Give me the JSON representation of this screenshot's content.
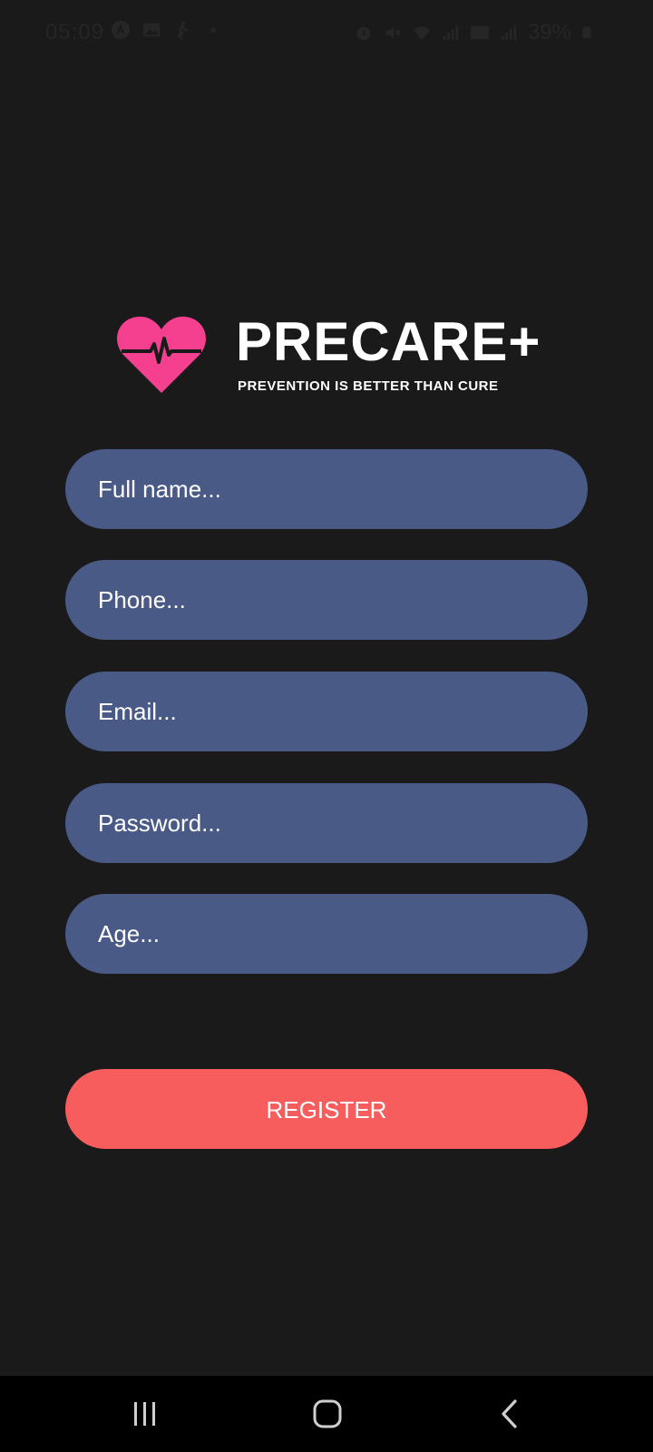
{
  "status_bar": {
    "time": "05:09",
    "battery": "39%",
    "left_icons": [
      "a-badge-icon",
      "image-icon",
      "walking-icon",
      "dot-icon"
    ],
    "right_icons": [
      "alarm-icon",
      "mute-icon",
      "wifi-icon",
      "signal-icon",
      "volte-icon",
      "signal-icon",
      "battery-icon"
    ]
  },
  "logo": {
    "title": "PRECARE+",
    "tagline": "PREVENTION IS BETTER THAN CURE",
    "heart_color": "#f5408f"
  },
  "form": {
    "full_name_placeholder": "Full name...",
    "phone_placeholder": "Phone...",
    "email_placeholder": "Email...",
    "password_placeholder": "Password...",
    "age_placeholder": "Age...",
    "field_color": "#4a5a86"
  },
  "register": {
    "label": "REGISTER",
    "color": "#f75d5d"
  },
  "nav_bar": {
    "icons": [
      "recents-icon",
      "home-icon",
      "back-icon"
    ]
  }
}
